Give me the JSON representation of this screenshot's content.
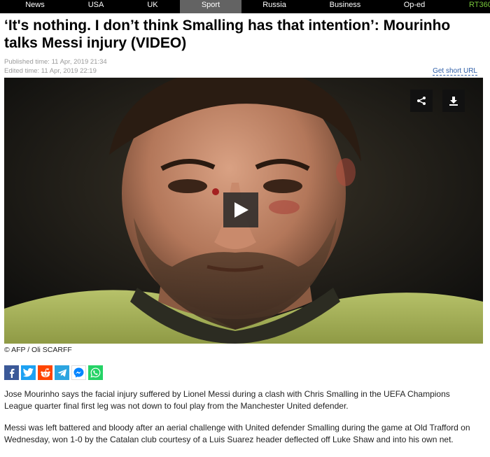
{
  "nav": {
    "items": [
      {
        "label": "News",
        "active": false
      },
      {
        "label": "USA",
        "active": false
      },
      {
        "label": "UK",
        "active": false
      },
      {
        "label": "Sport",
        "active": true
      },
      {
        "label": "Russia",
        "active": false
      },
      {
        "label": "Business",
        "active": false
      },
      {
        "label": "Op-ed",
        "active": false
      },
      {
        "label": "RT360",
        "active": false
      }
    ]
  },
  "article": {
    "title": "‘It's nothing. I don’t think Smalling has that intention’: Mourinho talks Messi injury (VIDEO)",
    "published": "Published time: 11 Apr, 2019 21:34",
    "edited": "Edited time: 11 Apr, 2019 22:19",
    "short_url_label": "Get short URL",
    "image_credit": "© AFP / Oli SCARFF",
    "paragraphs": [
      "Jose Mourinho says the facial injury suffered by Lionel Messi during a clash with Chris Smalling in the UEFA Champions League quarter final first leg was not down to foul play from the Manchester United defender.",
      "Messi was left battered and bloody after an aerial challenge with United defender Smalling during the game at Old Trafford on Wednesday, won 1-0 by the Catalan club courtesy of a Luis Suarez header deflected off Luke Shaw and into his own net."
    ]
  },
  "video": {
    "share_icon": "share-icon",
    "download_icon": "download-icon",
    "play_icon": "play-icon"
  },
  "social": [
    {
      "name": "facebook",
      "color": "#3b5998"
    },
    {
      "name": "twitter",
      "color": "#1da1f2"
    },
    {
      "name": "reddit",
      "color": "#ff4500"
    },
    {
      "name": "telegram",
      "color": "#2ca5e0"
    },
    {
      "name": "messenger",
      "color": "#0084ff"
    },
    {
      "name": "whatsapp",
      "color": "#25d366"
    }
  ],
  "colors": {
    "nav_bg": "#000000",
    "nav_active": "#636363",
    "brand": "#77c63a",
    "link": "#2f5fa8"
  }
}
